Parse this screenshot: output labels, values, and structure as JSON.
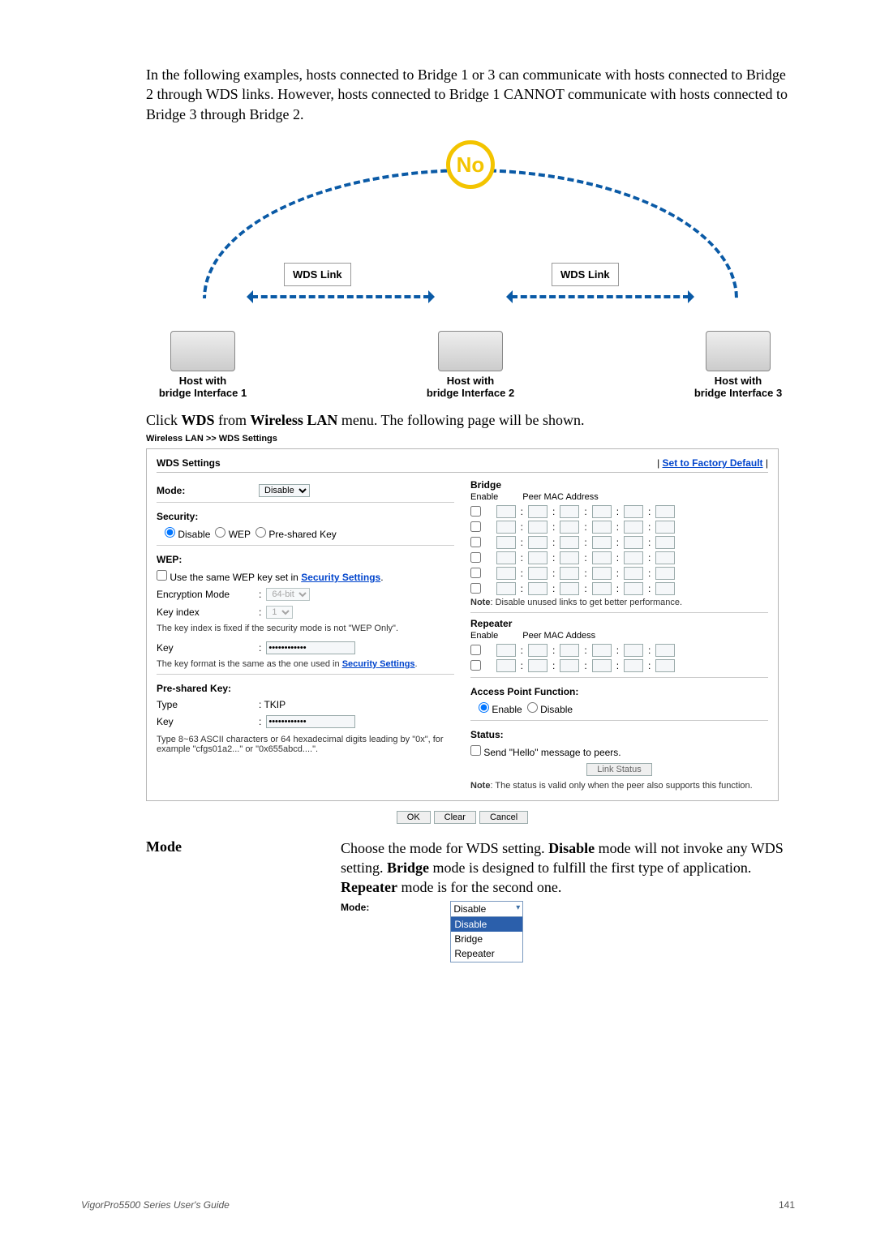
{
  "intro": "In the following examples, hosts connected to Bridge 1 or 3 can communicate with hosts connected to Bridge 2 through WDS links. However, hosts connected to Bridge 1 CANNOT communicate with hosts connected to Bridge 3 through Bridge 2.",
  "diagram": {
    "no": "No",
    "wds": "WDS Link",
    "host_with": "Host with",
    "bi1": "bridge Interface 1",
    "bi2": "bridge Interface 2",
    "bi3": "bridge Interface 3"
  },
  "click_pre": "Click ",
  "click_wds": "WDS",
  "click_mid": " from ",
  "click_wlan": "Wireless LAN",
  "click_end": " menu. The following page will be shown.",
  "breadcrumb": "Wireless LAN >> WDS Settings",
  "panel": {
    "title": "WDS Settings",
    "reset": "Set to Factory Default",
    "mode_lbl": "Mode:",
    "mode_opts": [
      "Disable"
    ],
    "security_lbl": "Security:",
    "sec_disable": "Disable",
    "sec_wep": "WEP",
    "sec_psk": "Pre-shared Key",
    "wep_lbl": "WEP:",
    "wep_same_pre": "Use the same WEP key set in ",
    "sec_settings_link": "Security Settings",
    "enc_mode_lbl": "Encryption Mode",
    "enc_mode_val": "64-bit",
    "keyidx_lbl": "Key index",
    "keyidx_val": "1",
    "keyidx_note": "The key index is fixed if the security mode is not \"WEP Only\".",
    "key_lbl": "Key",
    "key_note_pre": "The key format is the same as the one used in ",
    "psk_lbl": "Pre-shared Key:",
    "type_lbl": "Type",
    "type_val": ": TKIP",
    "psk_key_lbl": "Key",
    "psk_note": "Type 8~63 ASCII characters or 64 hexadecimal digits leading by \"0x\", for example \"cfgs01a2...\" or \"0x655abcd....\".",
    "bridge_lbl": "Bridge",
    "enable_lbl": "Enable",
    "peer_lbl": "Peer MAC Address",
    "bridge_note_pre": "Note",
    "bridge_note": ": Disable unused links to get better performance.",
    "repeater_lbl": "Repeater",
    "repeater_peer": "Peer MAC Addess",
    "apf_lbl": "Access Point Function:",
    "apf_enable": "Enable",
    "apf_disable": "Disable",
    "status_lbl": "Status:",
    "hello": "Send \"Hello\" message to peers.",
    "link_status_btn": "Link Status",
    "status_note_pre": "Note",
    "status_note": ": The status is valid only when the peer also supports this function.",
    "ok": "OK",
    "clear": "Clear",
    "cancel": "Cancel"
  },
  "mode_block": {
    "lbl": "Mode",
    "t1": "Choose the mode for WDS setting. ",
    "b1": "Disable",
    "t2": " mode will not invoke any WDS setting. ",
    "b2": "Bridge",
    "t3": " mode is designed to fulfill the first type of application. ",
    "b3": "Repeater",
    "t4": " mode is for the second one.",
    "mini_lbl": "Mode:",
    "opt_sel": "Disable",
    "opt1": "Disable",
    "opt2": "Bridge",
    "opt3": "Repeater"
  },
  "footer": {
    "guide": "VigorPro5500 Series User's Guide",
    "page": "141"
  }
}
